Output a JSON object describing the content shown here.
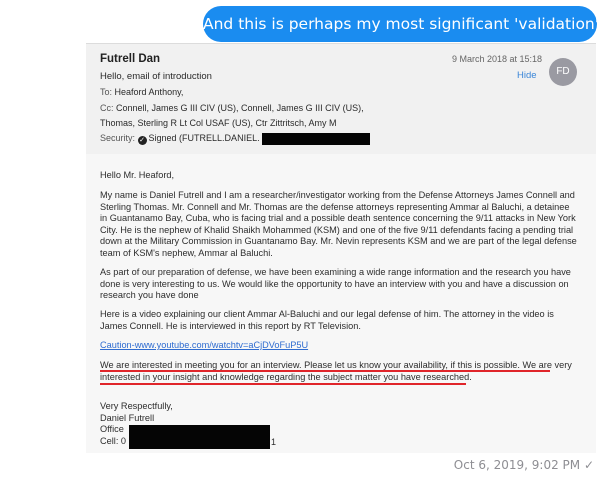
{
  "message": {
    "bubble_text": "And this is perhaps my most significant 'validation':",
    "timestamp": "Oct 6, 2019, 9:02 PM ✓",
    "bubble_color": "#1a8cf0"
  },
  "email": {
    "sender": "Futrell Dan",
    "date": "9 March 2018 at 15:18",
    "hide_label": "Hide",
    "avatar_initials": "FD",
    "subject": "Hello, email of introduction",
    "to_label": "To:",
    "to_value": "Heaford Anthony,",
    "cc_label": "Cc:",
    "cc_line1": "Connell, James G III CIV (US),    Connell, James G III CIV (US),",
    "cc_line2": "Thomas, Sterling R Lt Col USAF (US),    Ctr Zittritsch, Amy M",
    "security_label": "Security:",
    "security_value": "Signed (FUTRELL.DANIEL.",
    "greeting": "Hello Mr. Heaford,",
    "para1": [
      "My name is Daniel Futrell and I am a researcher/investigator working from the Defense Attorneys James Connell and",
      "Sterling Thomas.  Mr. Connell and Mr. Thomas are the defense attorneys representing Ammar al Baluchi, a detainee",
      "in Guantanamo Bay, Cuba, who is facing trial and a possible death sentence concerning the 9/11 attacks in New York",
      "City. He is the nephew of Khalid Shaikh Mohammed (KSM) and one of the five 9/11 defendants facing a pending trial",
      "down at the Military Commission in Guantanamo Bay. Mr. Nevin represents KSM and we are part of the legal defense",
      "team of KSM's nephew, Ammar al Baluchi."
    ],
    "para2": [
      "As part of our preparation of defense, we have been examining a wide range information and the research you have",
      "done is very interesting to us.  We would like the opportunity to have an interview with you and have a discussion on",
      "research you have done"
    ],
    "para3": [
      "Here is a video explaining our client Ammar Al-Baluchi and our legal defense of him.  The attorney in the video is",
      "James Connell.  He is interviewed in this report by RT Television."
    ],
    "link": "Caution-www.youtube.com/watchtv=aCjDVoFuP5U",
    "para4": [
      "We are interested in meeting you for an interview. Please let us know your availability, if this is possible. We are very",
      "interested in your insight and knowledge regarding the subject matter you have researched."
    ],
    "closing": "Very Respectfully,",
    "sig_name": "Daniel Futrell",
    "sig_office": "Office",
    "sig_cell": "Cell: 0",
    "sig_cell_tail": "1",
    "highlight_color": "#e0252a"
  }
}
